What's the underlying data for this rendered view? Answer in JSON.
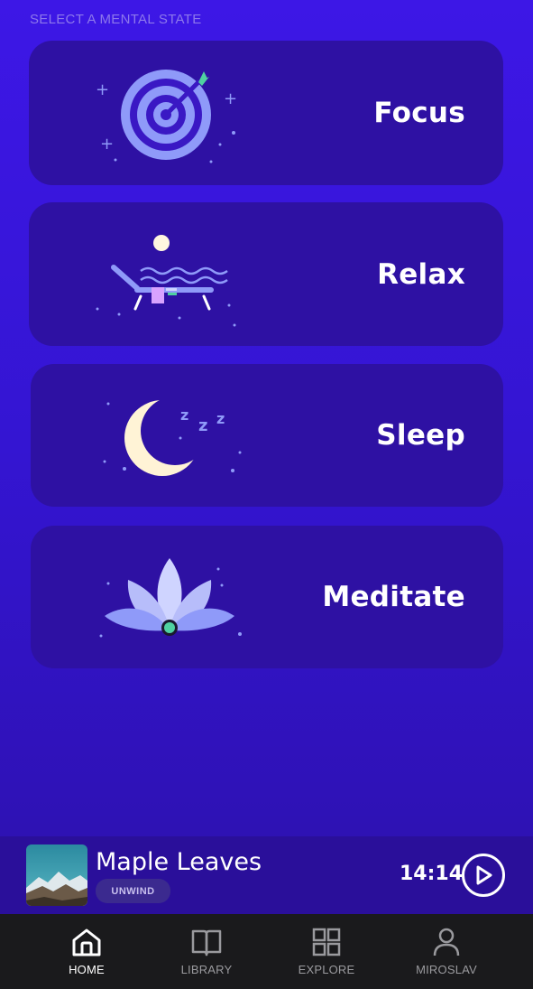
{
  "header": {
    "section_label": "SELECT A MENTAL STATE"
  },
  "states": [
    {
      "label": "Focus",
      "icon": "target-icon"
    },
    {
      "label": "Relax",
      "icon": "lounge-chair-icon"
    },
    {
      "label": "Sleep",
      "icon": "moon-icon"
    },
    {
      "label": "Meditate",
      "icon": "lotus-icon"
    }
  ],
  "player": {
    "track_title": "Maple Leaves",
    "tag": "UNWIND",
    "time": "14:14",
    "thumbnail": "mountain-landscape"
  },
  "tabs": [
    {
      "label": "HOME",
      "icon": "home-icon",
      "active": true
    },
    {
      "label": "LIBRARY",
      "icon": "book-icon",
      "active": false
    },
    {
      "label": "EXPLORE",
      "icon": "grid-icon",
      "active": false
    },
    {
      "label": "MIROSLAV",
      "icon": "user-icon",
      "active": false
    }
  ],
  "colors": {
    "background": "#3d17e6",
    "card": "#2e11a3",
    "player": "#2a0f9a",
    "tabbar": "#1a1a1c",
    "accent_light": "#8f9af9"
  }
}
